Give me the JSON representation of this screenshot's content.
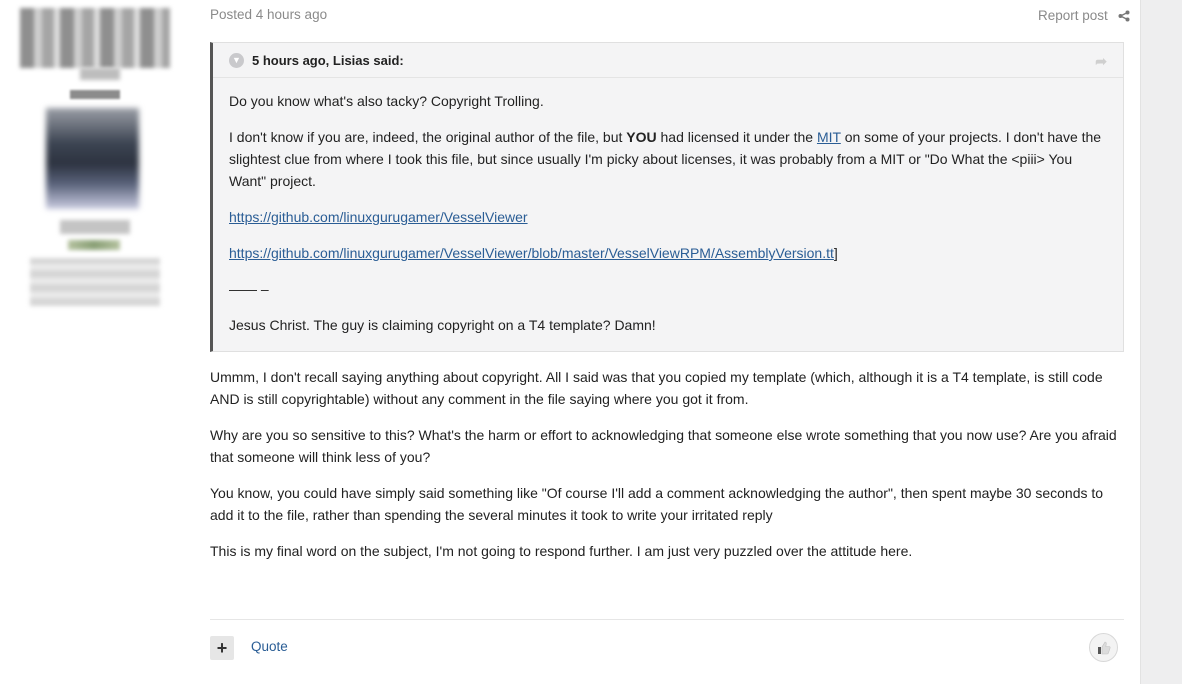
{
  "post": {
    "posted": "Posted 4 hours ago",
    "report": "Report post"
  },
  "quote": {
    "header": "5 hours ago, Lisias said:",
    "p1": "Do you know what's also tacky? Copyright Trolling.",
    "p2_a": "I don't know if you are, indeed, the original author of the file, but ",
    "p2_bold": "YOU",
    "p2_b": " had licensed it under the ",
    "p2_link": "MIT",
    "p2_c": " on some of your projects. I don't have the slightest clue from where I took this file, but since usually I'm picky about licenses, it was probably from a MIT or \"Do What the <piii> You Want\" project.",
    "link1": "https://github.com/linuxgurugamer/VesselViewer",
    "link2": "https://github.com/linuxgurugamer/VesselViewer/blob/master/VesselViewRPM/AssemblyVersion.tt",
    "link2_suffix": "]",
    "divider": "—— –",
    "p_last": "Jesus Christ. The guy is claiming copyright on a T4 template? Damn!"
  },
  "reply": {
    "p1": "Ummm, I don't recall saying anything about copyright.  All I said was that you copied my template (which, although it is a T4 template, is still code AND is still copyrightable) without any comment in the file saying where you got it from.",
    "p2": "Why are you so sensitive to this?  What's the harm or effort to acknowledging that someone else wrote something that you now use?  Are you afraid that someone will think less of you?",
    "p3": "You know, you could have simply said something like \"Of course I'll add a comment acknowledging the author\", then spent maybe 30 seconds to add it to the file, rather than spending the several minutes it took to write your irritated reply",
    "p4": "This is my final word on the subject, I'm not going to respond further.  I am just very puzzled over the attitude here."
  },
  "footer": {
    "plus": "+",
    "quote": "Quote"
  },
  "icons": {
    "share": "share-icon",
    "toggle": "chevron-down-icon",
    "jump": "forward-arrow-icon",
    "like": "thumbs-up-icon"
  }
}
